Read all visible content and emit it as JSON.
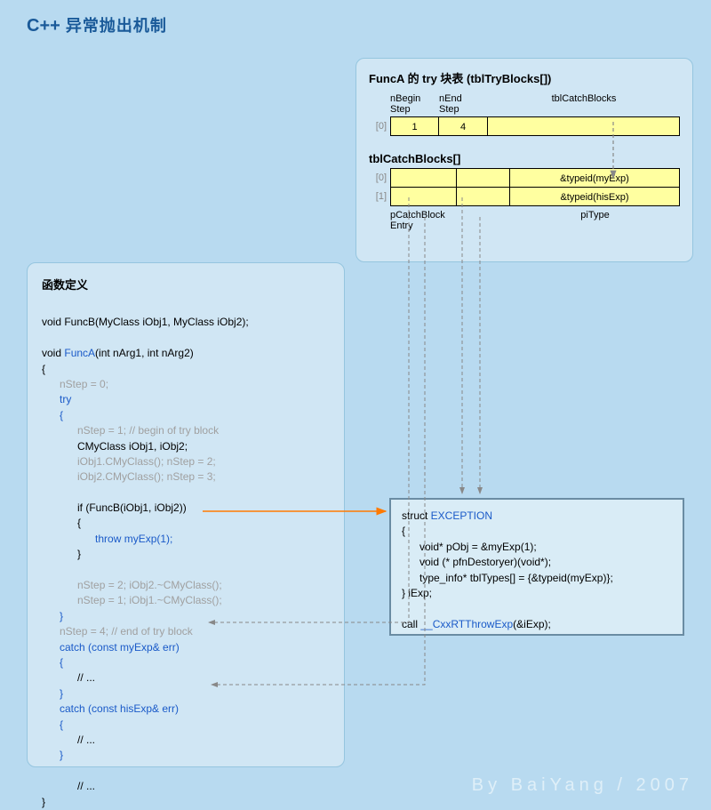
{
  "title_cpp": "C++",
  "title_rest": " 异常抛出机制",
  "tryblocks": {
    "title": "FuncA 的 try 块表 (tblTryBlocks[])",
    "hdr1": "nBegin\nStep",
    "hdr2": "nEnd\nStep",
    "hdr3": "tblCatchBlocks",
    "idx0": "[0]",
    "v1": "1",
    "v2": "4",
    "catch_title": "tblCatchBlocks[]",
    "c_idx0": "[0]",
    "c_idx1": "[1]",
    "c0_type": "&typeid(myExp)",
    "c1_type": "&typeid(hisExp)",
    "ftr1": "pCatchBlock\nEntry",
    "ftr2": "piType"
  },
  "fndef": {
    "title": "函数定义",
    "l01": "void FuncB(MyClass iObj1, MyClass iObj2);",
    "l02": "void ",
    "l02b": "FuncA",
    "l02c": "(int nArg1, int nArg2)",
    "l03": "{",
    "l04": "      nStep = 0;",
    "l05": "      try",
    "l06": "      {",
    "l07": "            nStep = 1; // begin of try block",
    "l08": "            CMyClass iObj1, iObj2;",
    "l09": "            iObj1.CMyClass(); nStep = 2;",
    "l10": "            iObj2.CMyClass(); nStep = 3;",
    "l11": "            if (FuncB(iObj1, iObj2))",
    "l12": "            {",
    "l13a": "                  ",
    "l13b": "throw myExp(1);",
    "l14": "            }",
    "l15": "            nStep = 2; iObj2.~CMyClass();",
    "l16": "            nStep = 1; iObj1.~CMyClass();",
    "l17": "      }",
    "l18": "      nStep = 4; // end of try block",
    "l19": "      catch (const myExp& err)",
    "l20": "      {",
    "l21": "            // ...",
    "l22": "      }",
    "l23": "      catch (const hisExp& err)",
    "l24": "      {",
    "l25": "            // ...",
    "l26": "      }",
    "l27": "            // ...",
    "l28": "}"
  },
  "expbox": {
    "l1a": "struct ",
    "l1b": "EXCEPTION",
    "l2": "{",
    "l3": "      void* pObj = &myExp(1);",
    "l4": "      void (* pfnDestoryer)(void*);",
    "l5": "      type_info* tblTypes[] = {&typeid(myExp)};",
    "l6": "} iExp;",
    "l7a": "call ",
    "l7b": "__CxxRTThrowExp",
    "l7c": "(&iExp);"
  },
  "author": "By BaiYang / 2007"
}
